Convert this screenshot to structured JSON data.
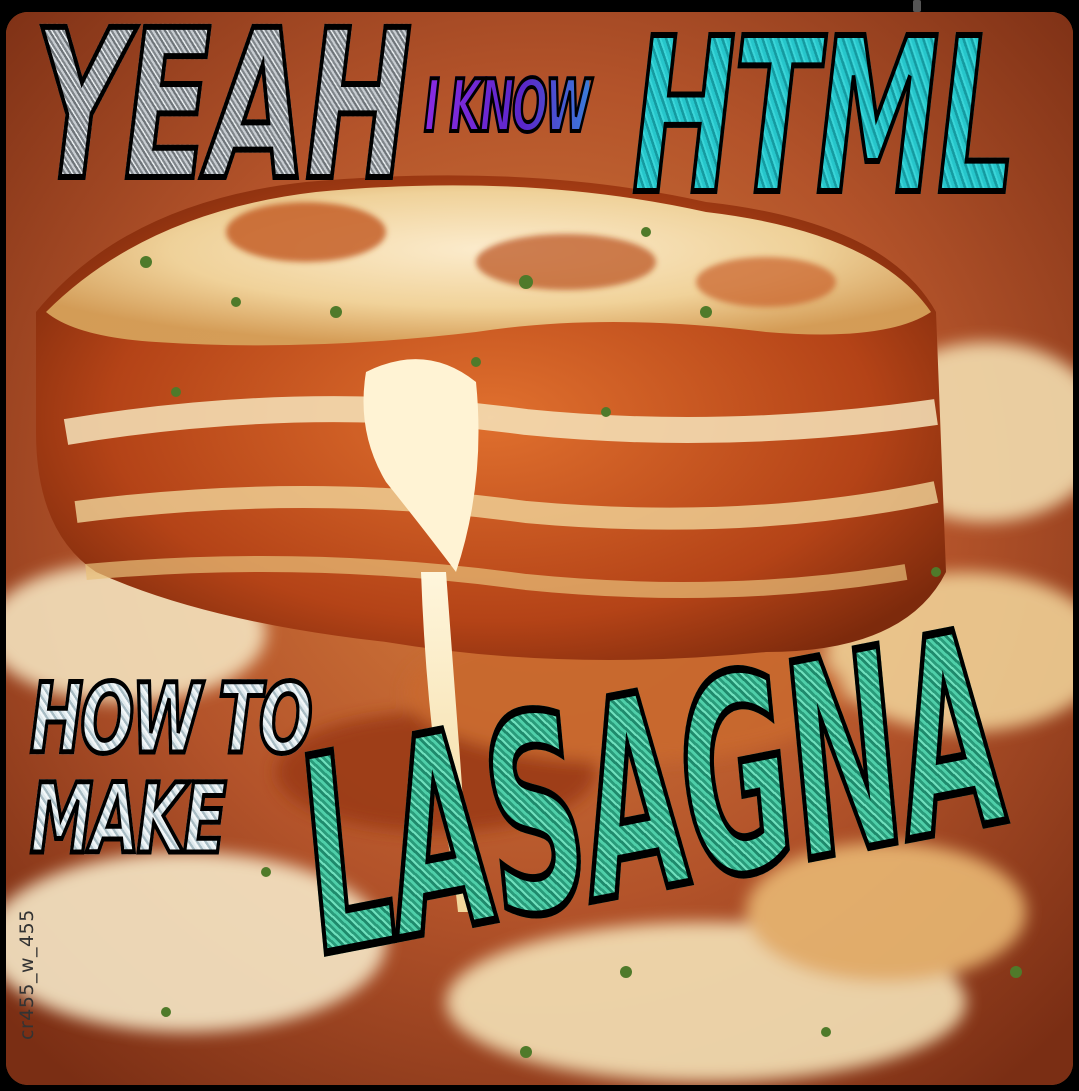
{
  "meme": {
    "headline_left": "YEAH",
    "headline_small": "I KNOW",
    "headline_right": "HTML",
    "subline_1": "HOW TO",
    "subline_2": "MAKE",
    "big_word": "LASAGNA"
  },
  "watermark": "cr455_w_455",
  "colors": {
    "silver_glitter": "#9aa0a6",
    "purple_gradient": "#7b2fd1",
    "teal": "#1fb3b8",
    "mint_glitter": "#3bb08f",
    "outline": "#000000"
  },
  "photo": {
    "subject": "lasagna-slice"
  }
}
